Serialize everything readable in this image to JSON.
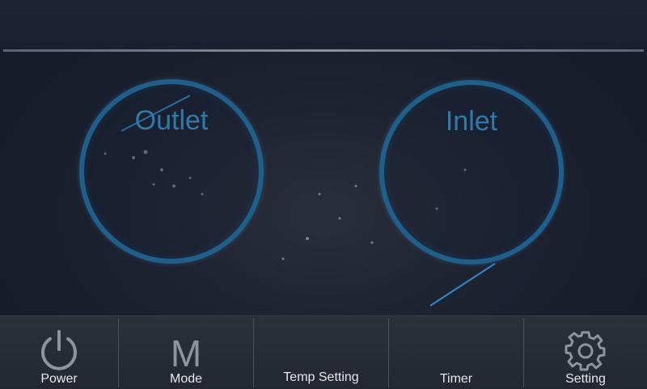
{
  "gauges": {
    "outlet": {
      "label": "Outlet"
    },
    "inlet": {
      "label": "Inlet"
    }
  },
  "nav": {
    "power": {
      "label": "Power",
      "icon": "power-icon"
    },
    "mode": {
      "label": "Mode",
      "glyph": "M"
    },
    "temp": {
      "label": "Temp Setting"
    },
    "timer": {
      "label": "Timer"
    },
    "setting": {
      "label": "Setting",
      "icon": "gear-icon"
    }
  },
  "colors": {
    "gauge_ring": "#1f5f8a",
    "gauge_label": "#2f7aa8",
    "background": "#1c2130",
    "navbar": "#2c3038"
  }
}
